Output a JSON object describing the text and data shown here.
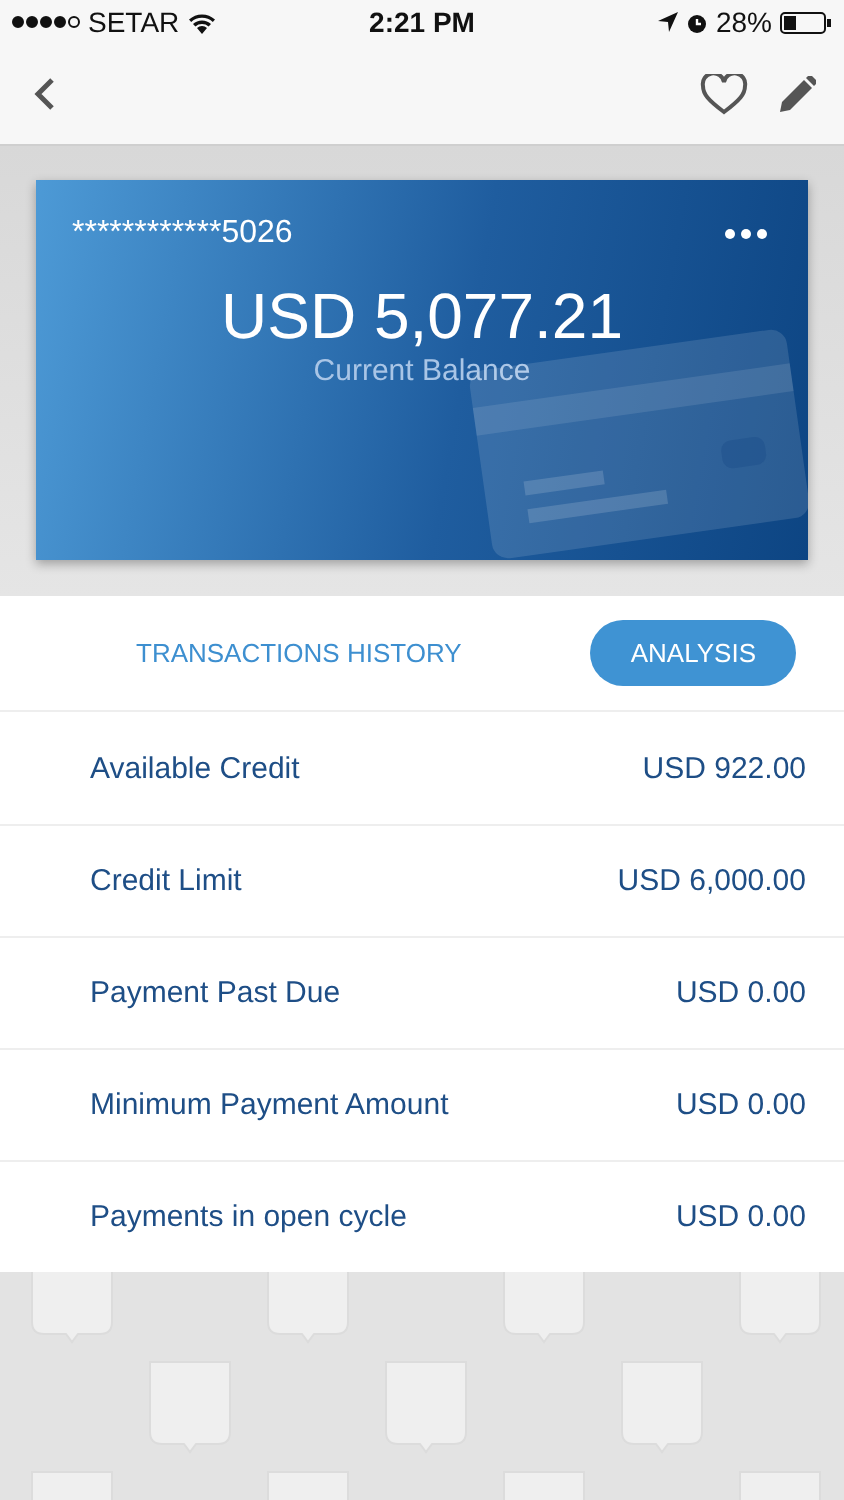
{
  "status_bar": {
    "carrier": "SETAR",
    "time": "2:21 PM",
    "battery": "28%"
  },
  "card": {
    "number": "************5026",
    "balance": "USD 5,077.21",
    "balance_label": "Current Balance"
  },
  "tabs": [
    {
      "label": "TRANSACTIONS HISTORY",
      "selected": false
    },
    {
      "label": "ANALYSIS",
      "selected": true
    }
  ],
  "rows": [
    {
      "label": "Available Credit",
      "value": "USD 922.00"
    },
    {
      "label": "Credit Limit",
      "value": "USD 6,000.00"
    },
    {
      "label": "Payment Past Due",
      "value": "USD 0.00"
    },
    {
      "label": "Minimum Payment Amount",
      "value": "USD 0.00"
    },
    {
      "label": "Payments in open cycle",
      "value": "USD 0.00"
    }
  ]
}
